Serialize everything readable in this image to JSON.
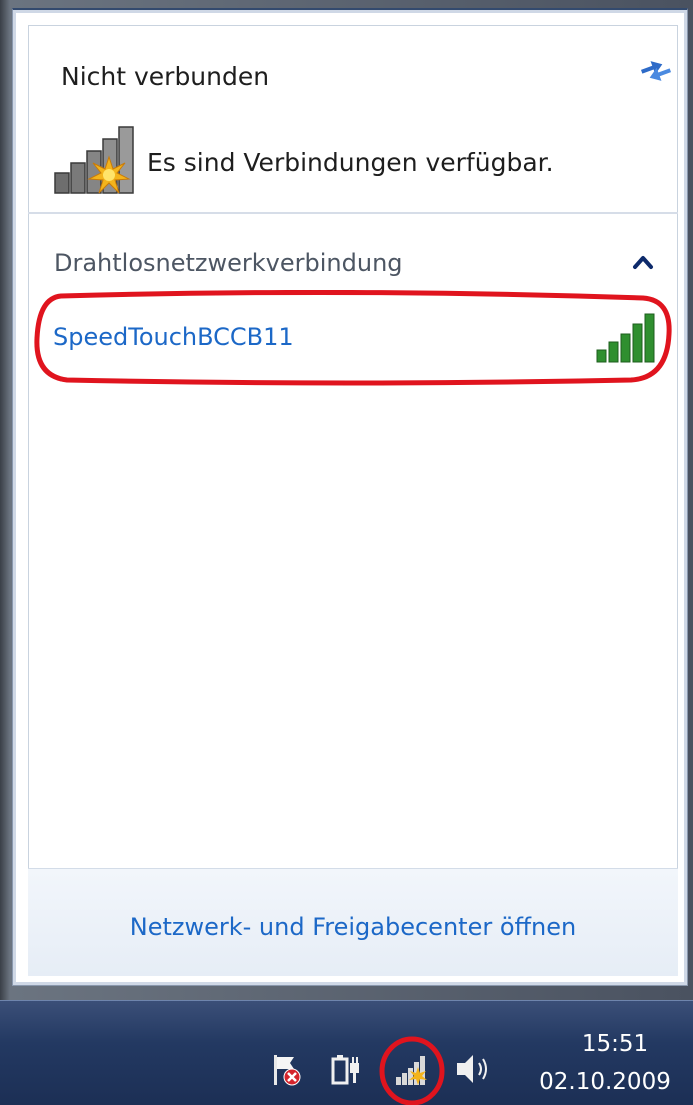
{
  "popup": {
    "status_title": "Nicht verbunden",
    "status_message": "Es sind Verbindungen verfügbar.",
    "refresh_icon": "refresh-arrows-icon",
    "status_icon": "network-connections-available-icon"
  },
  "section": {
    "title": "Drahtlosnetzwerkverbindung",
    "collapse_icon": "chevron-up-icon",
    "networks": [
      {
        "name": "SpeedTouchBCCB11",
        "signal_icon": "signal-strength-icon",
        "signal_level": 1.0
      }
    ]
  },
  "footer": {
    "link_label": "Netzwerk- und Freigabecenter öffnen"
  },
  "taskbar": {
    "tray_icons": [
      "action-center-flag-icon",
      "power-plug-icon",
      "network-icon",
      "volume-icon"
    ],
    "clock_time": "15:51",
    "clock_date": "02.10.2009"
  },
  "colors": {
    "link": "#1c68c7",
    "highlight_ring": "#e0141e",
    "signal_bars": "#2f8f2f",
    "taskbar": "#233962"
  }
}
